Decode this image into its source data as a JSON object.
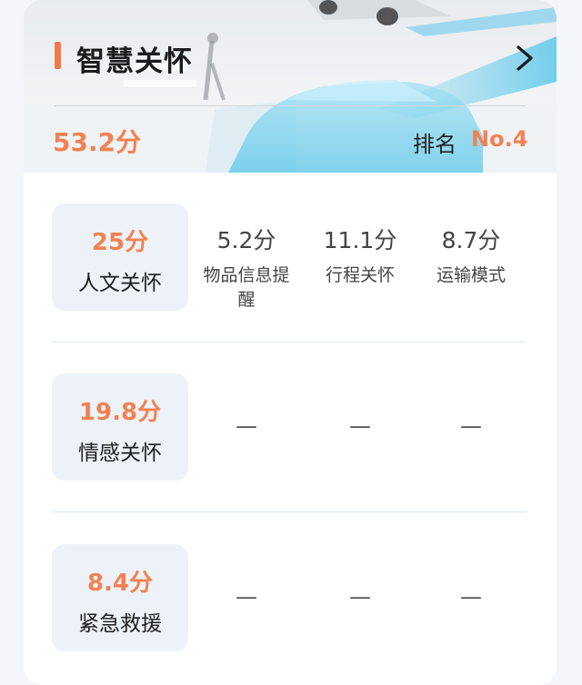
{
  "header": {
    "title": "智慧关怀",
    "total_score": "53.2分",
    "rank_label": "排名",
    "rank_value": "No.4"
  },
  "rows": [
    {
      "main": {
        "value": "25分",
        "label": "人文关怀"
      },
      "cells": [
        {
          "value": "5.2分",
          "label": "物品信息提醒"
        },
        {
          "value": "11.1分",
          "label": "行程关怀"
        },
        {
          "value": "8.7分",
          "label": "运输模式"
        }
      ]
    },
    {
      "main": {
        "value": "19.8分",
        "label": "情感关怀"
      },
      "cells": [
        {
          "dash": "—"
        },
        {
          "dash": "—"
        },
        {
          "dash": "—"
        }
      ]
    },
    {
      "main": {
        "value": "8.4分",
        "label": "紧急救援"
      },
      "cells": [
        {
          "dash": "—"
        },
        {
          "dash": "—"
        },
        {
          "dash": "—"
        }
      ]
    }
  ],
  "colors": {
    "accent": "#f28152",
    "tile_bg": "#edf2f9"
  },
  "icons": {
    "expand": "chevron-right-icon"
  }
}
